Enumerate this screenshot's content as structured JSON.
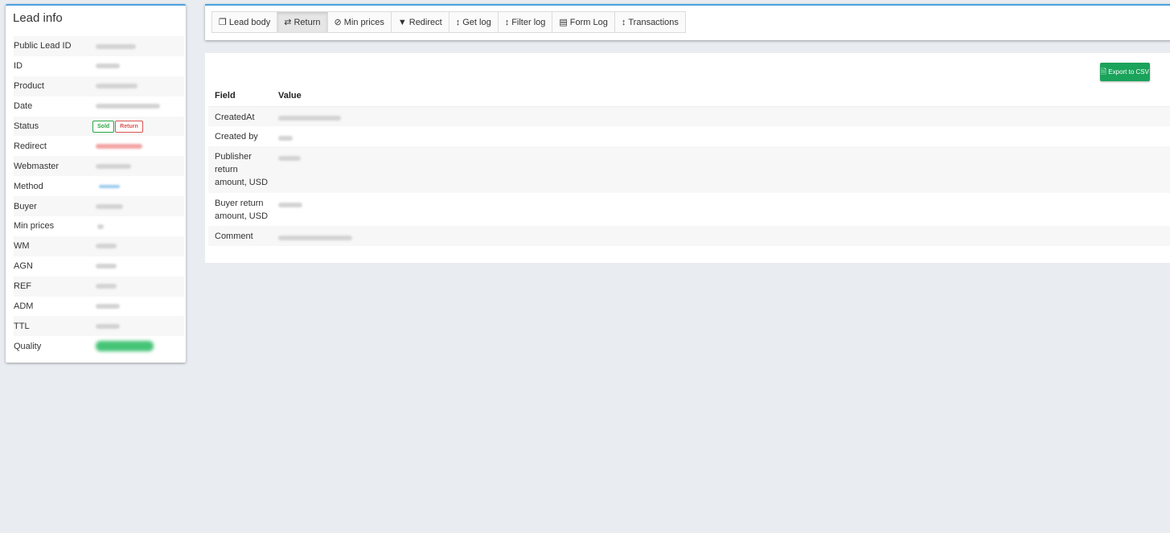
{
  "lead_info": {
    "title": "Lead info",
    "rows": [
      {
        "key": "Public Lead ID"
      },
      {
        "key": "ID"
      },
      {
        "key": "Product"
      },
      {
        "key": "Date"
      },
      {
        "key": "Status",
        "badges": [
          "Sold",
          "Return"
        ]
      },
      {
        "key": "Redirect"
      },
      {
        "key": "Webmaster"
      },
      {
        "key": "Method"
      },
      {
        "key": "Buyer"
      },
      {
        "key": "Min prices"
      },
      {
        "key": "WM"
      },
      {
        "key": "AGN"
      },
      {
        "key": "REF"
      },
      {
        "key": "ADM"
      },
      {
        "key": "TTL"
      },
      {
        "key": "Quality"
      }
    ]
  },
  "tabs": [
    {
      "label": "Lead body",
      "icon": "copy-icon"
    },
    {
      "label": "Return",
      "icon": "exchange-icon",
      "active": true
    },
    {
      "label": "Min prices",
      "icon": "ban-icon"
    },
    {
      "label": "Redirect",
      "icon": "filter-icon"
    },
    {
      "label": "Get log",
      "icon": "vertical-arrows-icon"
    },
    {
      "label": "Filter log",
      "icon": "vertical-arrows-icon"
    },
    {
      "label": "Form Log",
      "icon": "id-card-icon"
    },
    {
      "label": "Transactions",
      "icon": "vertical-arrows-icon"
    }
  ],
  "return_panel": {
    "export_label": "Export to CSV",
    "columns": [
      "Field",
      "Value"
    ],
    "rows": [
      {
        "field": "CreatedAt"
      },
      {
        "field": "Created by"
      },
      {
        "field": "Publisher return amount, USD"
      },
      {
        "field": "Buyer return amount, USD"
      },
      {
        "field": "Comment"
      }
    ]
  },
  "colors": {
    "accent": "#4aa3df",
    "export": "#1aa35a",
    "sold": "#28a745",
    "return": "#d9534f"
  }
}
